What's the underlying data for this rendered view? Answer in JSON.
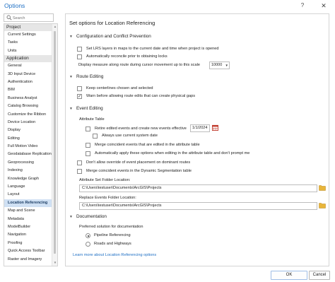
{
  "window": {
    "title": "Options",
    "help_label": "?",
    "close_label": "✕"
  },
  "search": {
    "placeholder": "Search"
  },
  "nav": {
    "project_group": "Project",
    "project_items": [
      "Current Settings",
      "Tasks",
      "Units"
    ],
    "application_group": "Application",
    "application_items": [
      "General",
      "3D Input Device",
      "Authentication",
      "BIM",
      "Business Analyst",
      "Catalog Browsing",
      "Customize the Ribbon",
      "Device Location",
      "Display",
      "Editing",
      "Full Motion Video",
      "Geodatabase Replication",
      "Geoprocessing",
      "Indexing",
      "Knowledge Graph",
      "Language",
      "Layout",
      "Location Referencing",
      "Map and Scene",
      "Metadata",
      "ModelBuilder",
      "Navigation",
      "Proofing",
      "Quick Access Toolbar",
      "Raster and Imagery"
    ],
    "selected": "Location Referencing"
  },
  "panel": {
    "heading": "Set options for Location Referencing",
    "config": {
      "title": "Configuration and Conflict Prevention",
      "set_lrs": "Set LRS layers in maps to the current date and time when project is opened",
      "auto_reconcile": "Automatically reconcile prior to obtaining locks",
      "display_measure": "Display measure along route during cursor movement up to this scale",
      "scale_value": "10000"
    },
    "route_editing": {
      "title": "Route Editing",
      "keep_centerlines": "Keep centerlines chosen and selected",
      "warn_physical_gaps": "Warn before allowing route edits that can create physical gaps"
    },
    "event_editing": {
      "title": "Event Editing",
      "attribute_table": "Attribute Table",
      "retire_edited": "Retire edited events and create new events effective",
      "effective_date": "1/1/2024",
      "always_current_date": "Always use current system date",
      "merge_coincident_table": "Merge coincident events that are edited in the attribute table",
      "auto_apply": "Automatically apply these options when editing in the attribute table and don't prompt me",
      "dont_override": "Don't allow override of event placement on dominant routes",
      "merge_dynamic_seg": "Merge coincident events in the Dynamic Segmentation table",
      "attribute_set_folder_label": "Attribute Set Folder Location:",
      "attribute_set_folder_path": "C:\\Users\\testuser\\Documents\\ArcGIS\\Projects",
      "replace_events_folder_label": "Replace Events Folder Location:",
      "replace_events_folder_path": "C:\\Users\\testuser\\Documents\\ArcGIS\\Projects"
    },
    "documentation": {
      "title": "Documentation",
      "preferred_label": "Preferred solution for documentation",
      "pipeline": "Pipeline Referencing",
      "roads": "Roads and Highways",
      "selected": "Pipeline Referencing"
    },
    "learn_more": "Learn more about Location Referencing options"
  },
  "footer": {
    "ok_label": "OK",
    "cancel_label": "Cancel"
  },
  "colors": {
    "accent": "#1e6fc4",
    "selected_bg": "#cfe0f3",
    "folder": "#e8b53a",
    "calendar": "#c0392b"
  }
}
